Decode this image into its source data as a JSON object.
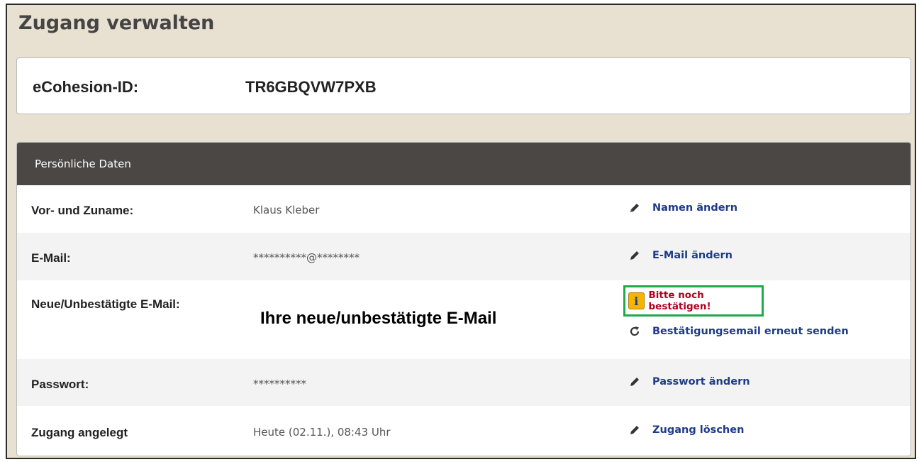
{
  "page": {
    "title": "Zugang verwalten"
  },
  "account": {
    "id_label": "eCohesion-ID:",
    "id_value": "TR6GBQVW7PXB"
  },
  "panel": {
    "header": "Persönliche Daten",
    "rows": [
      {
        "label": "Vor- und Zuname:",
        "value": "Klaus Kleber",
        "action": "Namen ändern",
        "icon": "pencil-icon"
      },
      {
        "label": "E-Mail:",
        "value": "**********@********",
        "action": "E-Mail ändern",
        "icon": "pencil-icon"
      },
      {
        "label": "Neue/Unbestätigte E-Mail:",
        "value": "Ihre neue/unbestätigte E-Mail",
        "notice": "Bitte noch bestätigen!",
        "notice_icon": "info-icon",
        "action": "Bestätigungsemail erneut senden",
        "icon": "refresh-icon"
      },
      {
        "label": "Passwort:",
        "value": "**********",
        "action": "Passwort ändern",
        "icon": "pencil-icon"
      },
      {
        "label": "Zugang angelegt",
        "value": "Heute (02.11.), 08:43 Uhr",
        "action": "Zugang löschen",
        "icon": "pencil-icon"
      }
    ]
  },
  "colors": {
    "link": "#1e3a8a",
    "notice": "#b00020",
    "highlight_border": "#1faa4a",
    "header_bg": "#4a4744",
    "page_bg": "#e8e0d0"
  }
}
